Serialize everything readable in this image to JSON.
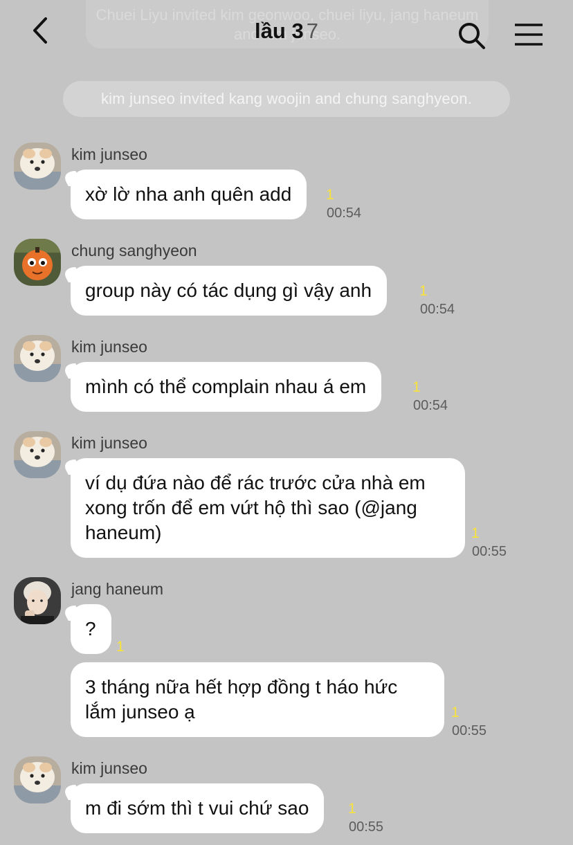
{
  "header": {
    "title": "lầu 3",
    "member_count": "7",
    "ghost_notice": "Chuei Liyu invited kim geonwoo, chuei liyu, jang haneum and kim junseo."
  },
  "system_notice": "kim junseo invited kang woojin and chung sanghyeon.",
  "icons": {
    "back": "chevron-left-icon",
    "search": "search-icon",
    "menu": "hamburger-menu-icon"
  },
  "colors": {
    "background": "#c4c4c4",
    "bubble": "#ffffff",
    "unread": "#f7e23c"
  },
  "messages": [
    {
      "sender": "kim junseo",
      "text": "xờ lờ nha anh quên add",
      "unread": "1",
      "time": "00:54"
    },
    {
      "sender": "chung sanghyeon",
      "text": "group này có tác dụng gì vậy anh",
      "unread": "1",
      "time": "00:54"
    },
    {
      "sender": "kim junseo",
      "text": "mình có thể complain nhau á em",
      "unread": "1",
      "time": "00:54"
    },
    {
      "sender": "kim junseo",
      "text": "ví dụ đứa nào để rác trước cửa nhà em xong trốn để em vứt hộ thì sao (@jang haneum)",
      "unread": "1",
      "time": "00:55"
    },
    {
      "sender": "jang haneum",
      "text": "?",
      "unread": "1",
      "time": ""
    },
    {
      "sender": "jang haneum",
      "text": "3 tháng nữa hết hợp đồng t háo hức lắm junseo ạ",
      "unread": "1",
      "time": "00:55"
    },
    {
      "sender": "kim junseo",
      "text": "m đi sớm thì t vui chứ sao",
      "unread": "1",
      "time": "00:55"
    }
  ]
}
